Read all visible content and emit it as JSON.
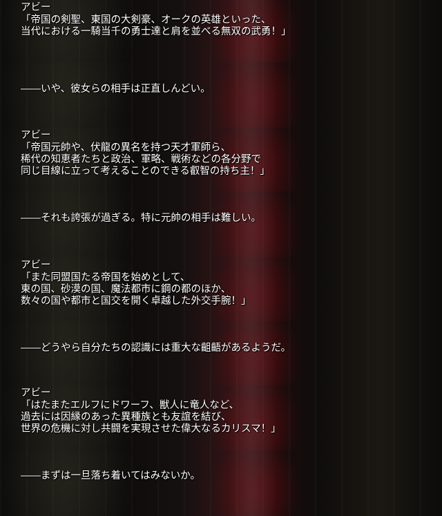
{
  "panels": [
    {
      "type": "dialogue",
      "speaker": "アビー",
      "lines": [
        "「帝国の剣聖、東国の大剣豪、オークの英雄といった、",
        "当代における一騎当千の勇士達と肩を並べる無双の武勇！」"
      ]
    },
    {
      "type": "narration",
      "text": "――いや、彼女らの相手は正直しんどい。"
    },
    {
      "type": "dialogue",
      "speaker": "アビー",
      "lines": [
        "「帝国元帥や、伏龍の異名を持つ天才軍師ら、",
        "稀代の知恵者たちと政治、軍略、戦術などの各分野で",
        "同じ目線に立って考えることのできる叡智の持ち主！」"
      ]
    },
    {
      "type": "narration",
      "text": "――それも誇張が過ぎる。特に元帥の相手は難しい。"
    },
    {
      "type": "dialogue",
      "speaker": "アビー",
      "lines": [
        "「また同盟国たる帝国を始めとして、",
        "東の国、砂漠の国、魔法都市に鋼の都のほか、",
        "数々の国や都市と国交を開く卓越した外交手腕！」"
      ]
    },
    {
      "type": "narration",
      "text": "――どうやら自分たちの認識には重大な齟齬があるようだ。"
    },
    {
      "type": "dialogue",
      "speaker": "アビー",
      "lines": [
        "「はたまたエルフにドワーフ、獣人に竜人など、",
        "過去には因縁のあった異種族とも友誼を結び、",
        "世界の危機に対し共闘を実現させた偉大なるカリスマ！」"
      ]
    },
    {
      "type": "narration",
      "text": "――まずは一旦落ち着いてはみないか。"
    }
  ]
}
